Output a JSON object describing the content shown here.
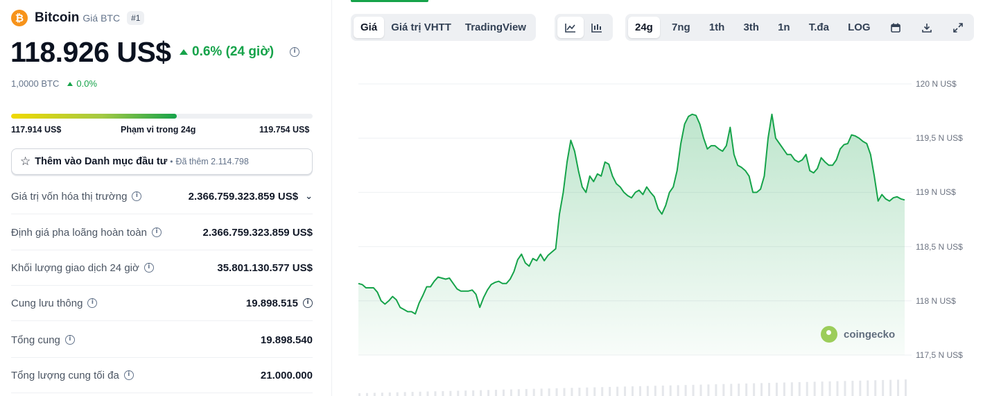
{
  "coin": {
    "logo_glyph": "₿",
    "name": "Bitcoin",
    "subtitle": "Giá BTC",
    "rank": "#1",
    "price": "118.926 US$",
    "change": "0.6% (24 giờ)",
    "btc_amount": "1,0000 BTC",
    "btc_change": "0.0%",
    "change_color": "#16a34a",
    "logo_color": "#f7931a"
  },
  "range": {
    "low": "117.914 US$",
    "label": "Phạm vi trong 24g",
    "high": "119.754 US$",
    "fill_fraction": 0.55
  },
  "watchlist": {
    "star_icon": "☆",
    "label": "Thêm vào Danh mục đầu tư",
    "separator": "•",
    "count": "Đã thêm 2.114.798"
  },
  "stats": [
    {
      "label": "Giá trị vốn hóa thị trường",
      "value": "2.366.759.323.859 US$",
      "label_info": true,
      "chevron": "⌄"
    },
    {
      "label": "Định giá pha loãng hoàn toàn",
      "value": "2.366.759.323.859 US$",
      "label_info": true
    },
    {
      "label": "Khối lượng giao dịch 24 giờ",
      "value": "35.801.130.577 US$",
      "label_info": true
    },
    {
      "label": "Cung lưu thông",
      "value": "19.898.515",
      "label_info": true,
      "value_info": true
    },
    {
      "label": "Tổng cung",
      "value": "19.898.540",
      "label_info": true
    },
    {
      "label": "Tổng lượng cung tối đa",
      "value": "21.000.000",
      "label_info": true
    }
  ],
  "chart_tabs": [
    {
      "label": "Giá",
      "active": true
    },
    {
      "label": "Giá trị VHTT",
      "active": false
    },
    {
      "label": "TradingView",
      "active": false
    }
  ],
  "chart_type_buttons": [
    {
      "icon": "line-chart-icon",
      "active": true
    },
    {
      "icon": "candlestick-icon",
      "active": false
    }
  ],
  "range_buttons": [
    {
      "label": "24g",
      "active": true
    },
    {
      "label": "7ng",
      "active": false
    },
    {
      "label": "1th",
      "active": false
    },
    {
      "label": "3th",
      "active": false
    },
    {
      "label": "1n",
      "active": false
    },
    {
      "label": "T.đa",
      "active": false
    },
    {
      "label": "LOG",
      "active": false
    }
  ],
  "tool_icons": [
    "calendar-icon",
    "download-icon",
    "fullscreen-icon"
  ],
  "watermark": "coingecko",
  "chart_data": {
    "type": "area",
    "x": [
      0,
      1,
      2,
      3,
      4,
      5,
      6,
      7,
      8,
      9,
      10,
      11,
      12,
      13,
      14,
      15,
      16,
      17,
      18,
      19,
      20,
      21,
      22,
      23,
      24,
      25,
      26,
      27,
      28,
      29,
      30,
      31,
      32,
      33,
      34,
      35,
      36,
      37,
      38,
      39,
      40,
      41,
      42,
      43,
      44,
      45,
      46,
      47,
      48,
      49,
      50,
      51,
      52,
      53,
      54,
      55,
      56,
      57,
      58,
      59,
      60,
      61,
      62,
      63,
      64,
      65,
      66,
      67,
      68,
      69,
      70,
      71,
      72,
      73,
      74,
      75,
      76,
      77,
      78,
      79,
      80,
      81,
      82,
      83,
      84,
      85,
      86,
      87,
      88,
      89,
      90,
      91,
      92,
      93,
      94,
      95,
      96,
      97,
      98,
      99,
      100,
      101,
      102,
      103,
      104,
      105,
      106,
      107,
      108,
      109,
      110,
      111,
      112,
      113,
      114,
      115,
      116,
      117,
      118,
      119,
      120,
      121,
      122,
      123,
      124,
      125,
      126,
      127,
      128,
      129,
      130,
      131,
      132,
      133,
      134,
      135,
      136,
      137,
      138,
      139,
      140,
      141,
      142,
      143,
      144
    ],
    "y": [
      118.16,
      118.15,
      118.12,
      118.12,
      118.12,
      118.08,
      118.0,
      117.97,
      118.0,
      118.04,
      118.01,
      117.94,
      117.92,
      117.9,
      117.9,
      117.88,
      117.98,
      118.05,
      118.13,
      118.13,
      118.18,
      118.22,
      118.21,
      118.2,
      118.21,
      118.16,
      118.11,
      118.09,
      118.09,
      118.09,
      118.1,
      118.06,
      117.94,
      118.03,
      118.1,
      118.15,
      118.17,
      118.18,
      118.16,
      118.16,
      118.2,
      118.27,
      118.38,
      118.43,
      118.35,
      118.32,
      118.39,
      118.37,
      118.43,
      118.37,
      118.42,
      118.45,
      118.48,
      118.8,
      119.0,
      119.28,
      119.48,
      119.38,
      119.2,
      119.05,
      119.0,
      119.15,
      119.1,
      119.17,
      119.15,
      119.28,
      119.26,
      119.15,
      119.08,
      119.05,
      119.0,
      118.97,
      118.95,
      119.0,
      119.02,
      118.98,
      119.05,
      119.0,
      118.96,
      118.85,
      118.8,
      118.88,
      119.0,
      119.05,
      119.2,
      119.45,
      119.63,
      119.7,
      119.72,
      119.71,
      119.63,
      119.5,
      119.4,
      119.43,
      119.43,
      119.4,
      119.38,
      119.43,
      119.6,
      119.35,
      119.25,
      119.23,
      119.2,
      119.15,
      119.0,
      119.0,
      119.03,
      119.15,
      119.5,
      119.72,
      119.5,
      119.45,
      119.4,
      119.35,
      119.35,
      119.3,
      119.28,
      119.3,
      119.35,
      119.2,
      119.18,
      119.22,
      119.32,
      119.28,
      119.25,
      119.25,
      119.3,
      119.4,
      119.44,
      119.45,
      119.53,
      119.52,
      119.5,
      119.47,
      119.45,
      119.35,
      119.15,
      118.92,
      118.98,
      118.94,
      118.92,
      118.95,
      118.96,
      118.94,
      118.93
    ],
    "ylim": [
      117.5,
      120.0
    ],
    "yticks": [
      "120 N US$",
      "119,5 N US$",
      "119 N US$",
      "118,5 N US$",
      "118 N US$",
      "117,5 N US$"
    ],
    "ytick_values": [
      120,
      119.5,
      119,
      118.5,
      118,
      117.5
    ],
    "line_color": "#16a34a",
    "grid": true
  }
}
